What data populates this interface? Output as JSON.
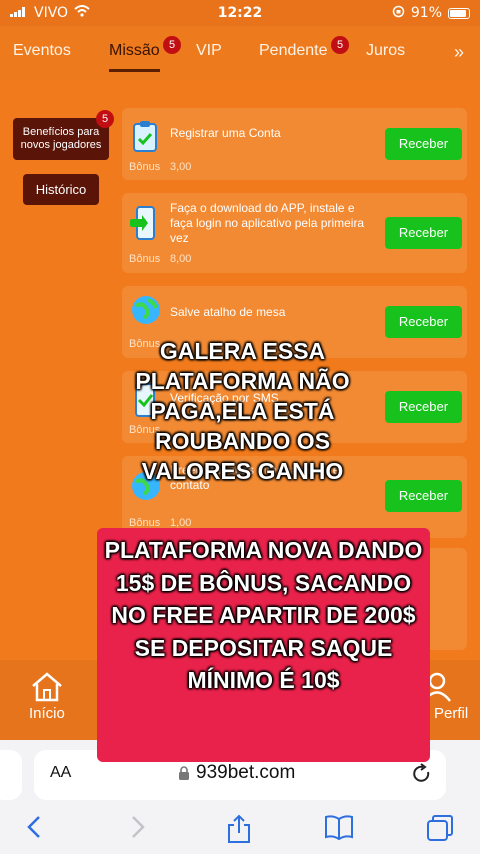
{
  "status_bar": {
    "carrier": "VIVO",
    "time": "12:22",
    "battery": "91%"
  },
  "tabs": [
    {
      "label": "Eventos"
    },
    {
      "label": "Missão",
      "badge": "5",
      "active": true
    },
    {
      "label": "VIP"
    },
    {
      "label": "Pendente",
      "badge": "5"
    },
    {
      "label": "Juros"
    }
  ],
  "sidebar": {
    "beneficios_label": "Benefícios para novos jogadores",
    "beneficios_badge": "5",
    "historico_label": "Histórico"
  },
  "missions": [
    {
      "title": "Registrar uma Conta",
      "bonus_label": "Bônus",
      "bonus_value": "3,00",
      "button": "Receber",
      "icon": "clipboard-icon"
    },
    {
      "title": "Faça o download do APP, instale e faça login no aplicativo pela primeira vez",
      "bonus_label": "Bônus",
      "bonus_value": "8,00",
      "button": "Receber",
      "icon": "phone-download-icon"
    },
    {
      "title": "Salve atalho de mesa",
      "bonus_label": "Bônus",
      "button": "Receber",
      "icon": "globe-icon"
    },
    {
      "title": "Verificação por SMS",
      "bonus_label": "Bônus",
      "button": "Receber",
      "icon": "phone-check-icon"
    },
    {
      "title": "Preencher suas informações de contato",
      "bonus_label": "Bônus",
      "bonus_value": "1,00",
      "button": "Receber",
      "icon": "globe-contact-icon"
    }
  ],
  "bottom_nav": {
    "home_label": "Início",
    "profile_label": "Perfil"
  },
  "browser": {
    "aa_label": "AA",
    "url": "939bet.com"
  },
  "overlay": {
    "top_text": "GALERA ESSA PLATAFORMA NÃO PAGA,ELA ESTÁ ROUBANDO OS VALORES GANHO",
    "box_text": "PLATAFORMA NOVA DANDO 15$ DE BÔNUS, SACANDO NO FREE APARTIR DE 200$ SE DEPOSITAR SAQUE MÍNIMO É 10$"
  },
  "colors": {
    "background": "#f07a1c",
    "card": "#f28a34",
    "receive_button": "#18c21c",
    "badge": "#c00e12",
    "overlay_box": "#e8224a"
  }
}
